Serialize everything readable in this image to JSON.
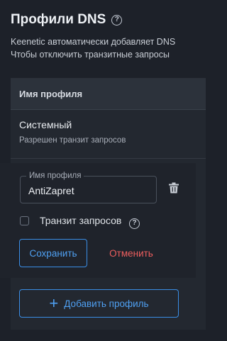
{
  "header": {
    "title": "Профили DNS",
    "help_icon": "help-circle-icon"
  },
  "description": {
    "line1": "Keenetic автоматически добавляет DNS",
    "line2": "Чтобы отключить транзитные запросы"
  },
  "table": {
    "column_header": "Имя профиля",
    "rows": [
      {
        "name": "Системный",
        "subtitle": "Разрешен транзит запросов"
      }
    ]
  },
  "edit_form": {
    "name_label": "Имя профиля",
    "name_value": "AntiZapret",
    "delete_icon": "trash-icon",
    "transit_label": "Транзит запросов",
    "transit_checked": false,
    "save_label": "Сохранить",
    "cancel_label": "Отменить"
  },
  "add_profile_label": "Добавить профиль",
  "colors": {
    "background": "#1d2129",
    "accent": "#3a8ee6",
    "danger": "#ee5e5e"
  }
}
